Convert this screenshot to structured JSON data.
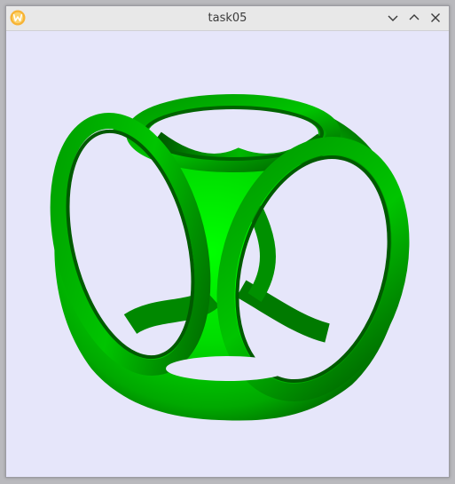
{
  "window": {
    "title": "task05",
    "app_icon": "w-logo-icon",
    "controls": [
      "minimize-icon",
      "maximize-icon",
      "close-icon"
    ]
  },
  "viewport": {
    "background": "#e6e6fa",
    "object_color": "#00cc00",
    "object_highlight": "#00ff00",
    "object_shadow": "#005500"
  }
}
